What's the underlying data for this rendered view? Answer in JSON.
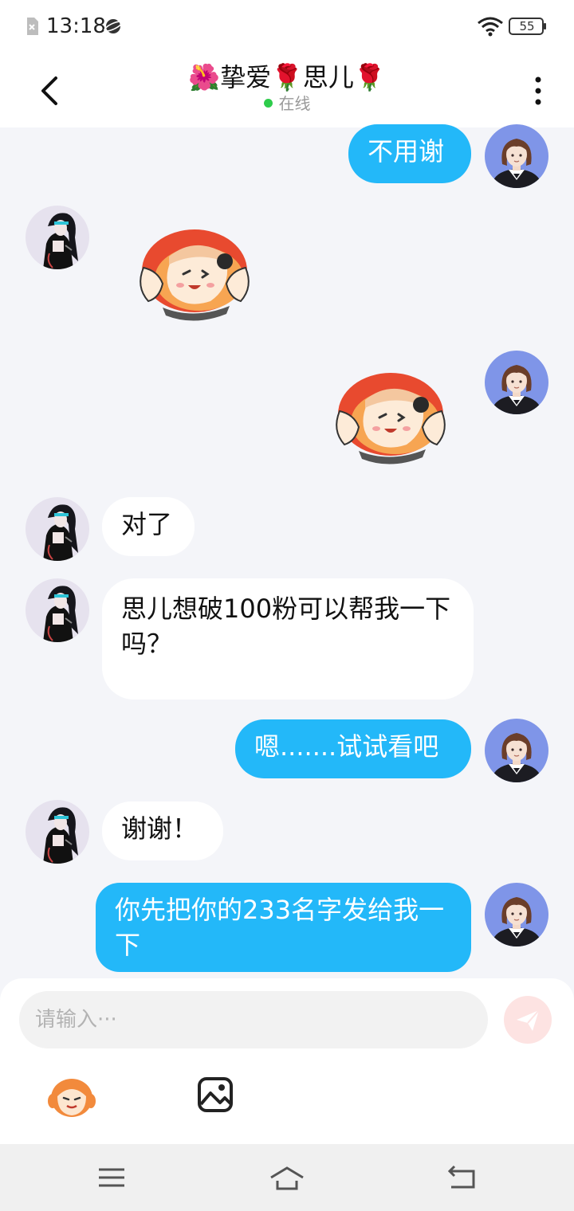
{
  "status_bar": {
    "time": "13:18",
    "battery": "55"
  },
  "header": {
    "title": "🌺挚爱🌹思儿🌹",
    "status": "在线"
  },
  "messages": [
    {
      "from": "me",
      "text": "不用谢"
    },
    {
      "from": "other",
      "sticker": "cartoon-girl-sticker"
    },
    {
      "from": "me",
      "sticker": "cartoon-girl-sticker"
    },
    {
      "from": "other",
      "text": "对了"
    },
    {
      "from": "other",
      "text": "思儿想破100粉可以帮我一下吗？"
    },
    {
      "from": "me",
      "text": "嗯.......试试看吧"
    },
    {
      "from": "other",
      "text": "谢谢！"
    },
    {
      "from": "me",
      "text": "你先把你的233名字发给我一下"
    }
  ],
  "composer": {
    "placeholder": "请输入···"
  },
  "colors": {
    "my_bubble": "#23b8f9",
    "other_bubble": "#ffffff",
    "background": "#f4f5f9",
    "send_button": "#fde3e2"
  }
}
